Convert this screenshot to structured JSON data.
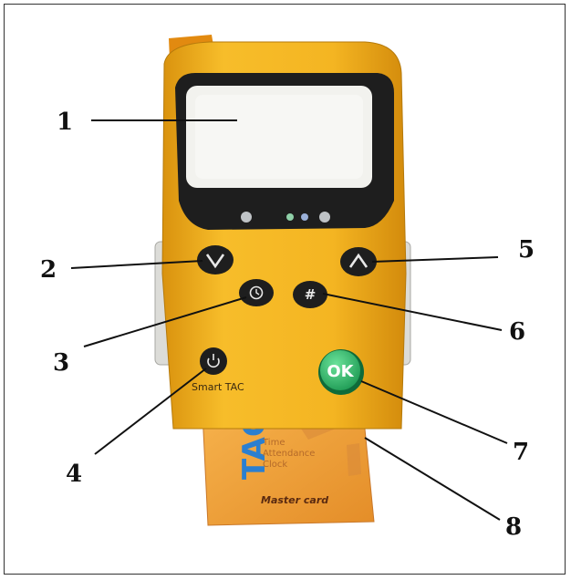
{
  "callouts": [
    {
      "id": "1",
      "label": "1"
    },
    {
      "id": "2",
      "label": "2"
    },
    {
      "id": "3",
      "label": "3"
    },
    {
      "id": "4",
      "label": "4"
    },
    {
      "id": "5",
      "label": "5"
    },
    {
      "id": "6",
      "label": "6"
    },
    {
      "id": "7",
      "label": "7"
    },
    {
      "id": "8",
      "label": "8"
    }
  ],
  "device": {
    "brand_label": "Smart TAC",
    "ok_label": "OK",
    "hash_symbol": "#",
    "card": {
      "logo_letters": "TAC",
      "line1": "Time",
      "line2": "Attendance",
      "line3": "Clock",
      "issuer": "Master card"
    }
  },
  "colors": {
    "device_body": "#f2b21a",
    "device_dark": "#1e1e1e",
    "screen": "#f2f2ee",
    "ok_button": "#2db36a",
    "card": "#f0a53a",
    "card_logo": "#2b7fd0"
  },
  "icons": {
    "down": "chevron-down-icon",
    "up": "chevron-up-icon",
    "clock": "clock-icon",
    "hash": "hash-icon",
    "power": "power-icon"
  }
}
